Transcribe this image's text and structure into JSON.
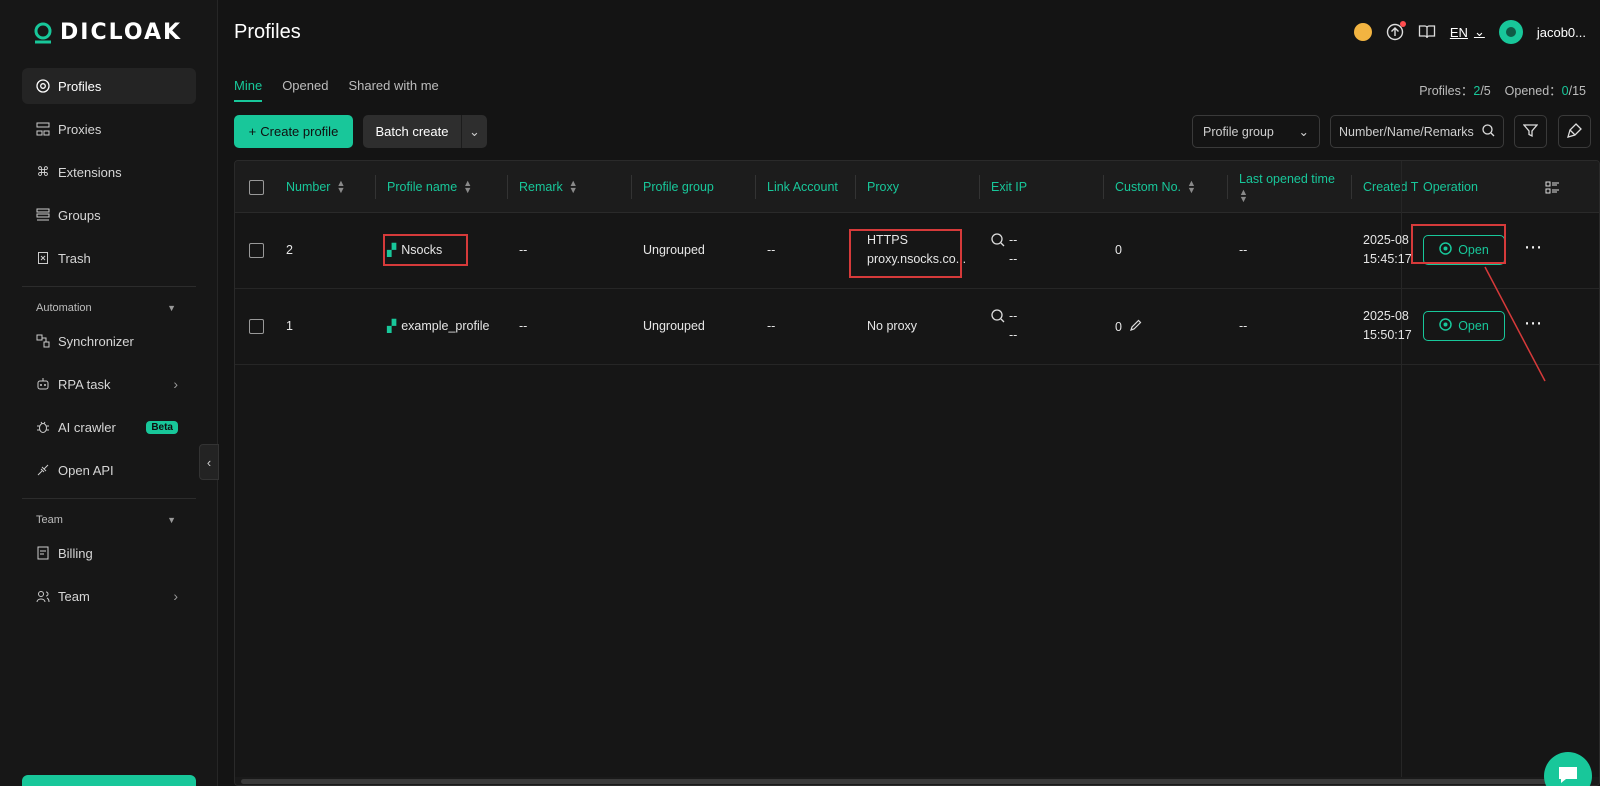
{
  "app": {
    "name": "DICLOAK",
    "brand_color": "#18c79a"
  },
  "sidebar": {
    "items": [
      {
        "label": "Profiles",
        "icon": "chrome-icon",
        "active": true
      },
      {
        "label": "Proxies",
        "icon": "network-icon"
      },
      {
        "label": "Extensions",
        "icon": "command-icon"
      },
      {
        "label": "Groups",
        "icon": "groups-icon"
      },
      {
        "label": "Trash",
        "icon": "trash-icon"
      }
    ],
    "automation_title": "Automation",
    "automation_items": [
      {
        "label": "Synchronizer",
        "icon": "sync-icon"
      },
      {
        "label": "RPA task",
        "icon": "robot-icon",
        "has_arrow": true
      },
      {
        "label": "AI crawler",
        "icon": "bug-icon",
        "badge": "Beta"
      },
      {
        "label": "Open API",
        "icon": "api-icon"
      }
    ],
    "team_title": "Team",
    "team_items": [
      {
        "label": "Billing",
        "icon": "billing-icon"
      },
      {
        "label": "Team",
        "icon": "team-icon",
        "has_arrow": true
      }
    ]
  },
  "header": {
    "title": "Profiles",
    "language": "EN",
    "username": "jacob0..."
  },
  "tabs": [
    "Mine",
    "Opened",
    "Shared with me"
  ],
  "stats": {
    "profiles_label": "Profiles：",
    "profiles_used": "2",
    "profiles_total": "/5",
    "opened_label": "Opened：",
    "opened_used": "0",
    "opened_total": "/15"
  },
  "toolbar": {
    "create_label": "Create profile",
    "batch_label": "Batch create",
    "group_select": "Profile group",
    "search_placeholder": "Number/Name/Remarks"
  },
  "table": {
    "headers": {
      "number": "Number",
      "profile_name": "Profile name",
      "remark": "Remark",
      "profile_group": "Profile group",
      "link_account": "Link Account",
      "proxy": "Proxy",
      "exit_ip": "Exit IP",
      "custom_no": "Custom No.",
      "last_opened": "Last opened time",
      "created": "Created T",
      "operation": "Operation"
    },
    "rows": [
      {
        "number": "2",
        "name": "Nsocks",
        "remark": "--",
        "group": "Ungrouped",
        "link": "--",
        "proxy_line1": "HTTPS",
        "proxy_line2": "proxy.nsocks.co...",
        "exit_ip_1": "--",
        "exit_ip_2": "--",
        "custom_no": "0",
        "last_opened": "--",
        "created_1": "2025-08",
        "created_2": "15:45:17",
        "open_label": "Open"
      },
      {
        "number": "1",
        "name": "example_profile",
        "remark": "--",
        "group": "Ungrouped",
        "link": "--",
        "proxy_line1": "No proxy",
        "proxy_line2": "",
        "exit_ip_1": "--",
        "exit_ip_2": "--",
        "custom_no": "0",
        "last_opened": "--",
        "created_1": "2025-08",
        "created_2": "15:50:17",
        "open_label": "Open"
      }
    ]
  }
}
